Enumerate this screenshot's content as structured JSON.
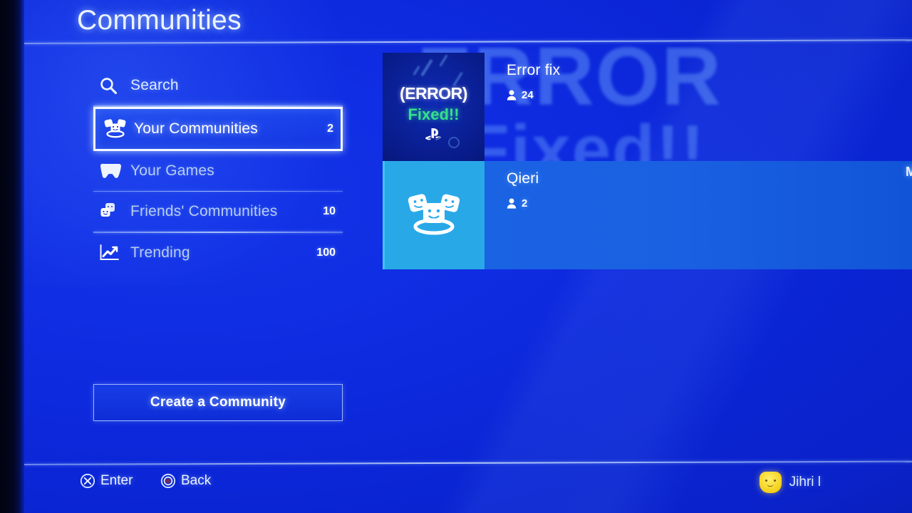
{
  "header": {
    "title": "Communities"
  },
  "sidebar": {
    "items": [
      {
        "label": "Search",
        "count": "",
        "icon": "search-icon",
        "selected": false
      },
      {
        "label": "Your Communities",
        "count": "2",
        "icon": "community-group-icon",
        "selected": true
      },
      {
        "label": "Your Games",
        "count": "",
        "icon": "gamepad-icon",
        "selected": false
      },
      {
        "label": "Friends' Communities",
        "count": "10",
        "icon": "stacked-faces-icon",
        "selected": false
      },
      {
        "label": "Trending",
        "count": "100",
        "icon": "trending-chart-icon",
        "selected": false
      }
    ],
    "create_button": "Create a Community"
  },
  "banner_watermark": {
    "line1": "ERROR",
    "line2": "Fixed!!"
  },
  "communities": [
    {
      "name": "Error fix",
      "members": "24",
      "thumbnail": {
        "type": "custom-image",
        "text_top": "(ERROR)",
        "text_bottom": "Fixed!!",
        "logo": "playstation-logo-icon",
        "top_color": "#ffffff",
        "bottom_color": "#35e08c"
      },
      "highlighted": false,
      "clipped_label": ""
    },
    {
      "name": "Qieri",
      "members": "2",
      "thumbnail": {
        "type": "default-community-icon",
        "text_top": "",
        "text_bottom": "",
        "logo": "community-faces-icon",
        "top_color": "#ffffff",
        "bottom_color": "#ffffff"
      },
      "highlighted": true,
      "clipped_label": "M"
    }
  ],
  "footer": {
    "hints": [
      {
        "icon": "cross-button-icon",
        "label": "Enter"
      },
      {
        "icon": "circle-button-icon",
        "label": "Back"
      }
    ],
    "user": {
      "name": "Jihri l",
      "avatar": "yellow-face-avatar"
    }
  },
  "colors": {
    "background_blue": "#0f2ce2",
    "highlight_blue": "#1a64e4",
    "thumbnail_cyan": "#29a8e8",
    "accent_green": "#35e08c",
    "text_white": "#ffffff",
    "avatar_yellow": "#f6d21e"
  }
}
